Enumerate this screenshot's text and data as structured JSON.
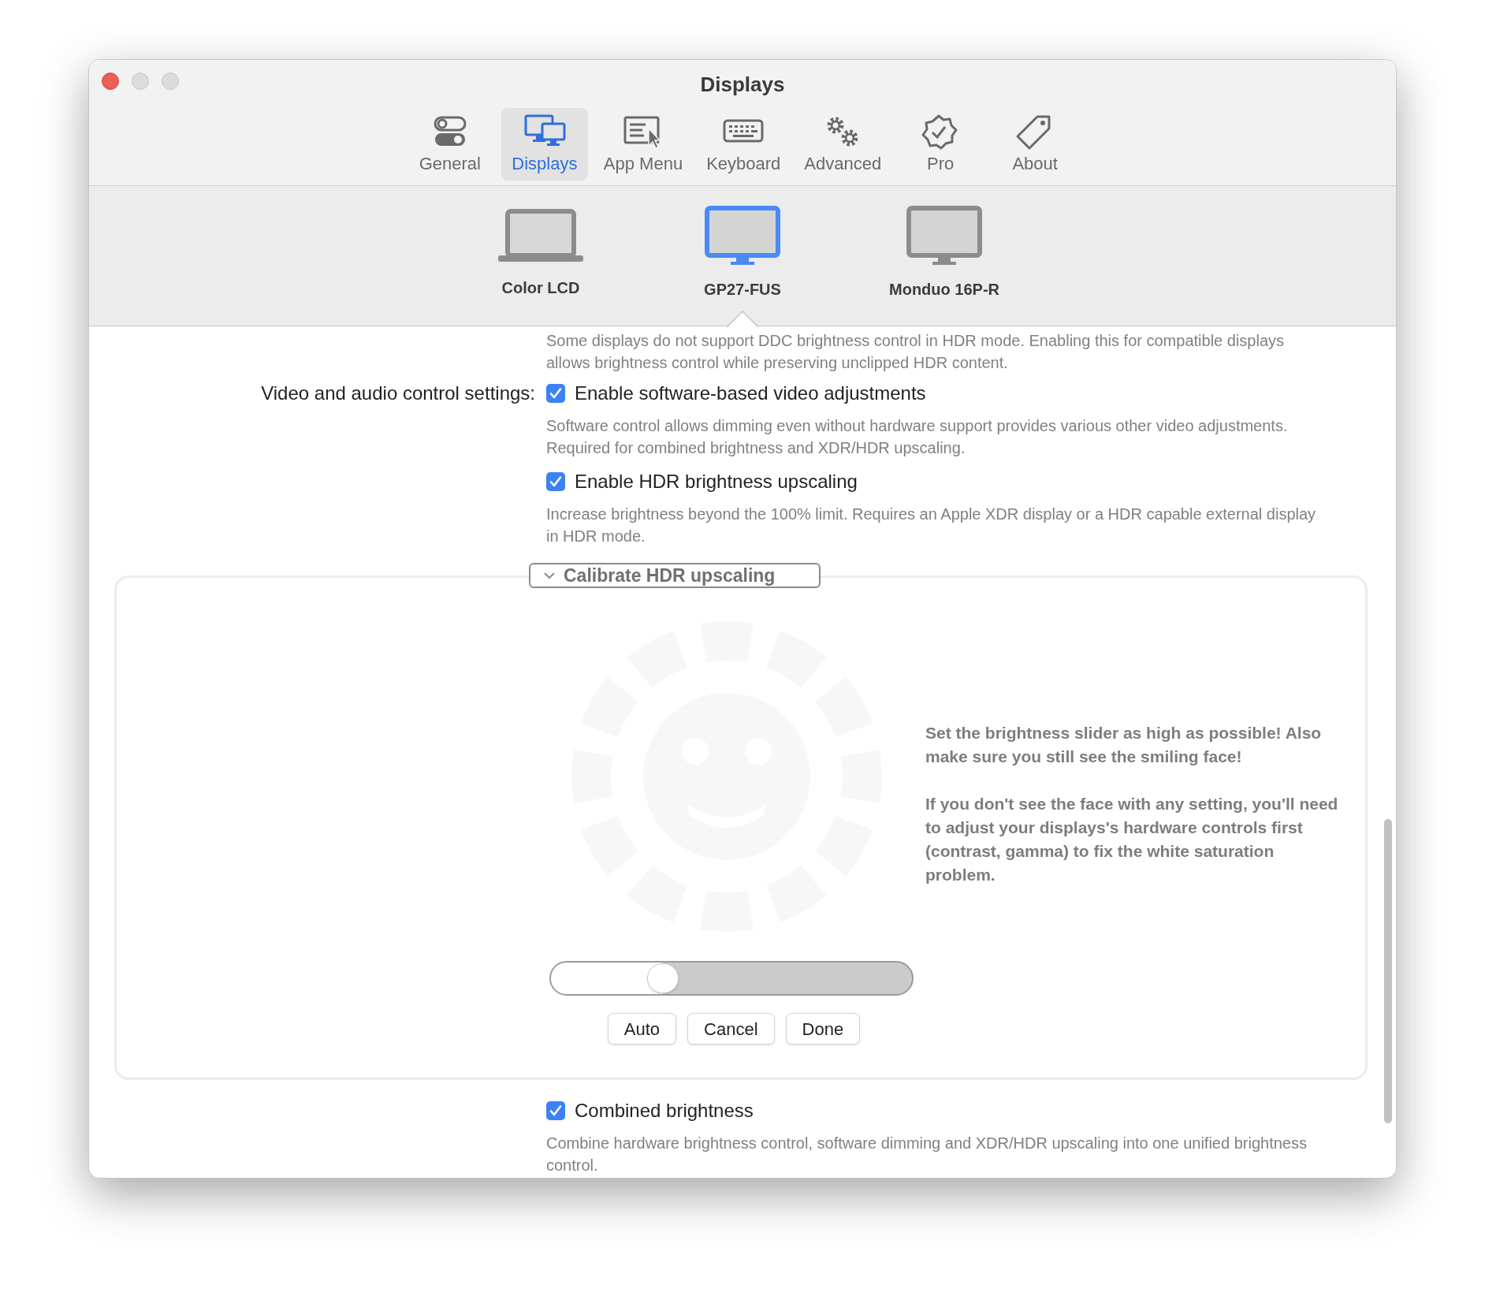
{
  "window": {
    "title": "Displays"
  },
  "toolbar": [
    {
      "label": "General",
      "kind": "toggles",
      "selected": false
    },
    {
      "label": "Displays",
      "kind": "displays",
      "selected": true
    },
    {
      "label": "App Menu",
      "kind": "menu",
      "selected": false
    },
    {
      "label": "Keyboard",
      "kind": "keyboard",
      "selected": false
    },
    {
      "label": "Advanced",
      "kind": "gears",
      "selected": false
    },
    {
      "label": "Pro",
      "kind": "badge",
      "selected": false
    },
    {
      "label": "About",
      "kind": "tag",
      "selected": false
    }
  ],
  "displays": [
    {
      "name": "Color LCD",
      "kind": "laptop",
      "selected": false
    },
    {
      "name": "GP27-FUS",
      "kind": "monitor",
      "selected": true
    },
    {
      "name": "Monduo 16P-R",
      "kind": "monitor",
      "selected": false
    }
  ],
  "settings": {
    "intro": "Some displays do not support DDC brightness control in HDR mode. Enabling this for compatible displays allows brightness control while preserving unclipped HDR content.",
    "section_label": "Video and audio control settings:",
    "options": [
      {
        "label": "Enable software-based video adjustments",
        "checked": true,
        "description": "Software control allows dimming even without hardware support provides various other video adjustments. Required for combined brightness and XDR/HDR upscaling."
      },
      {
        "label": "Enable HDR brightness upscaling",
        "checked": true,
        "description": "Increase brightness beyond the 100% limit. Requires an Apple XDR display or a HDR capable external display in HDR mode."
      }
    ]
  },
  "calibration": {
    "title": "Calibrate HDR upscaling",
    "expanded": true,
    "instructions": [
      "Set the brightness slider as high as possible! Also make sure you still see the smiling face!",
      "If you don't see the face with any setting, you'll need to adjust your displays's hardware controls first (contrast, gamma) to fix the white saturation problem."
    ],
    "slider": {
      "level": 0.31
    },
    "buttons": [
      "Auto",
      "Cancel",
      "Done"
    ]
  },
  "more_options": [
    {
      "label": "Combined brightness",
      "checked": true,
      "description": "Combine hardware brightness control, software dimming and XDR/HDR upscaling into one unified brightness control."
    }
  ]
}
